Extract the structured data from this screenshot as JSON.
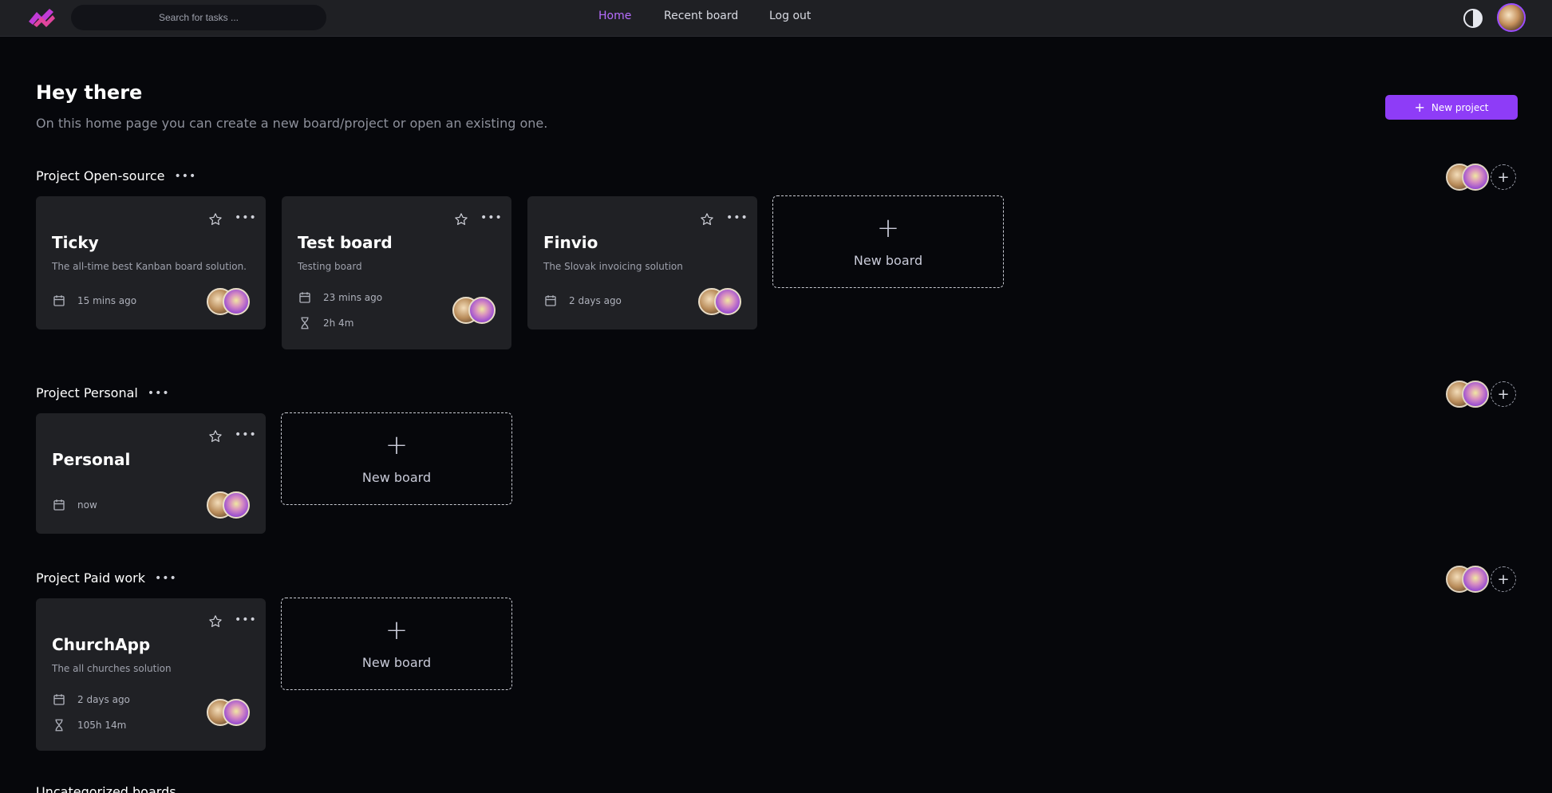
{
  "topbar": {
    "search_placeholder": "Search for tasks ...",
    "nav": [
      {
        "label": "Home",
        "active": true
      },
      {
        "label": "Recent board",
        "active": false
      },
      {
        "label": "Log out",
        "active": false
      }
    ]
  },
  "header": {
    "title": "Hey there",
    "subtitle": "On this home page you can create a new board/project or open an existing one.",
    "new_project_label": "New project"
  },
  "sections": [
    {
      "title": "Project Open-source",
      "boards": [
        {
          "title": "Ticky",
          "description": "The all-time best Kanban board solution.",
          "updated": "15 mins ago",
          "time_spent": ""
        },
        {
          "title": "Test board",
          "description": "Testing board",
          "updated": "23 mins ago",
          "time_spent": "2h 4m"
        },
        {
          "title": "Finvio",
          "description": "The Slovak invoicing solution",
          "updated": "2 days ago",
          "time_spent": ""
        }
      ],
      "new_board_label": "New board"
    },
    {
      "title": "Project Personal",
      "boards": [
        {
          "title": "Personal",
          "description": "",
          "updated": "now",
          "time_spent": ""
        }
      ],
      "new_board_label": "New board"
    },
    {
      "title": "Project Paid work",
      "boards": [
        {
          "title": "ChurchApp",
          "description": "The all churches solution",
          "updated": "2 days ago",
          "time_spent": "105h 14m"
        }
      ],
      "new_board_label": "New board"
    }
  ],
  "uncategorized_title": "Uncategorized boards",
  "colors": {
    "accent": "#8e3cf7",
    "nav_active": "#b76dff",
    "background": "#06070b",
    "card": "#202125"
  },
  "icons": {
    "logo": "ticky-logo-icon",
    "theme": "contrast-icon",
    "favorite": "star-icon",
    "more": "more-icon",
    "calendar": "calendar-icon",
    "timer": "hourglass-icon",
    "add": "plus-icon"
  }
}
